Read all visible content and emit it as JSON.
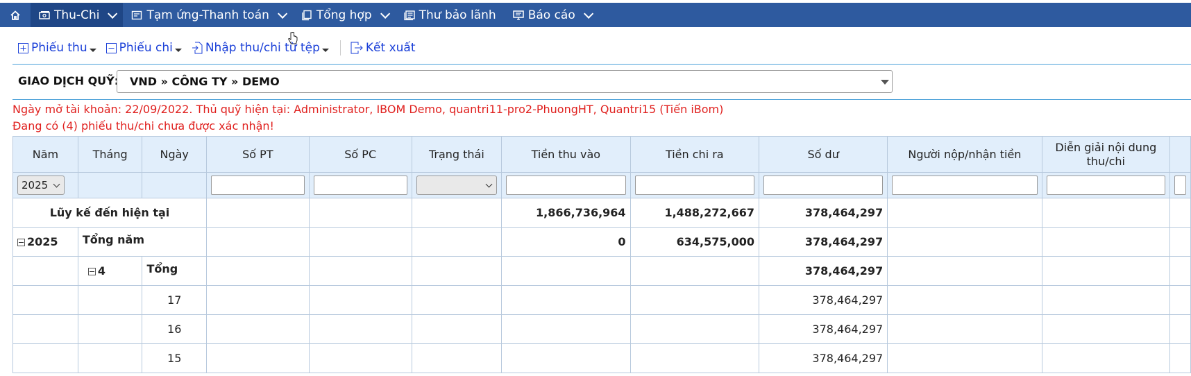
{
  "nav": {
    "items": [
      {
        "label": "Thu-Chi",
        "icon": "cash-icon",
        "active": true
      },
      {
        "label": "Tạm ứng-Thanh toán",
        "icon": "receipt-icon"
      },
      {
        "label": "Tổng hợp",
        "icon": "copy-icon"
      },
      {
        "label": "Thư bảo lãnh",
        "icon": "document-icon"
      },
      {
        "label": "Báo cáo",
        "icon": "monitor-icon"
      }
    ]
  },
  "toolbar": {
    "receipt": "Phiếu thu",
    "payment": "Phiếu chi",
    "import": "Nhập thu/chi từ tệp",
    "export": "Kết xuất"
  },
  "fund": {
    "label": "GIAO DỊCH QUỸ:",
    "value": "VND » CÔNG TY » DEMO"
  },
  "messages": {
    "account_info": "Ngày mở tài khoản: 22/09/2022. Thủ quỹ hiện tại: Administrator, IBOM Demo, quantri11-pro2-PhuongHT, Quantri15 (Tiến iBom)",
    "pending": "Đang có (4) phiếu thu/chi chưa được xác nhận!"
  },
  "table": {
    "headers": [
      "Năm",
      "Tháng",
      "Ngày",
      "Số PT",
      "Số PC",
      "Trạng thái",
      "Tiền thu vào",
      "Tiền chi ra",
      "Số dư",
      "Người nộp/nhận tiền",
      "Diễn giải nội dung thu/chi"
    ],
    "filter": {
      "year": "2025"
    },
    "cumulative": {
      "label": "Lũy kế đến hiện tại",
      "income": "1,866,736,964",
      "expense": "1,488,272,667",
      "balance": "378,464,297"
    },
    "year_row": {
      "year": "2025",
      "label": "Tổng năm",
      "income": "0",
      "expense": "634,575,000",
      "balance": "378,464,297"
    },
    "month_row": {
      "month": "4",
      "label": "Tổng",
      "balance": "378,464,297"
    },
    "day_rows": [
      {
        "day": "17",
        "balance": "378,464,297"
      },
      {
        "day": "16",
        "balance": "378,464,297"
      },
      {
        "day": "15",
        "balance": "378,464,297"
      }
    ]
  }
}
